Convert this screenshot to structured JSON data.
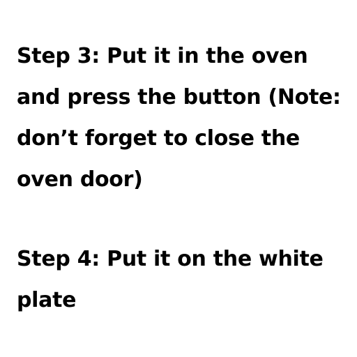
{
  "steps": [
    {
      "text": "Step 3: Put it in the oven and press the button (Note: don’t forget to close the oven door)"
    },
    {
      "text": "Step 4: Put it on the white plate"
    }
  ],
  "colors": {
    "background": "#ffffff",
    "text": "#000000"
  }
}
